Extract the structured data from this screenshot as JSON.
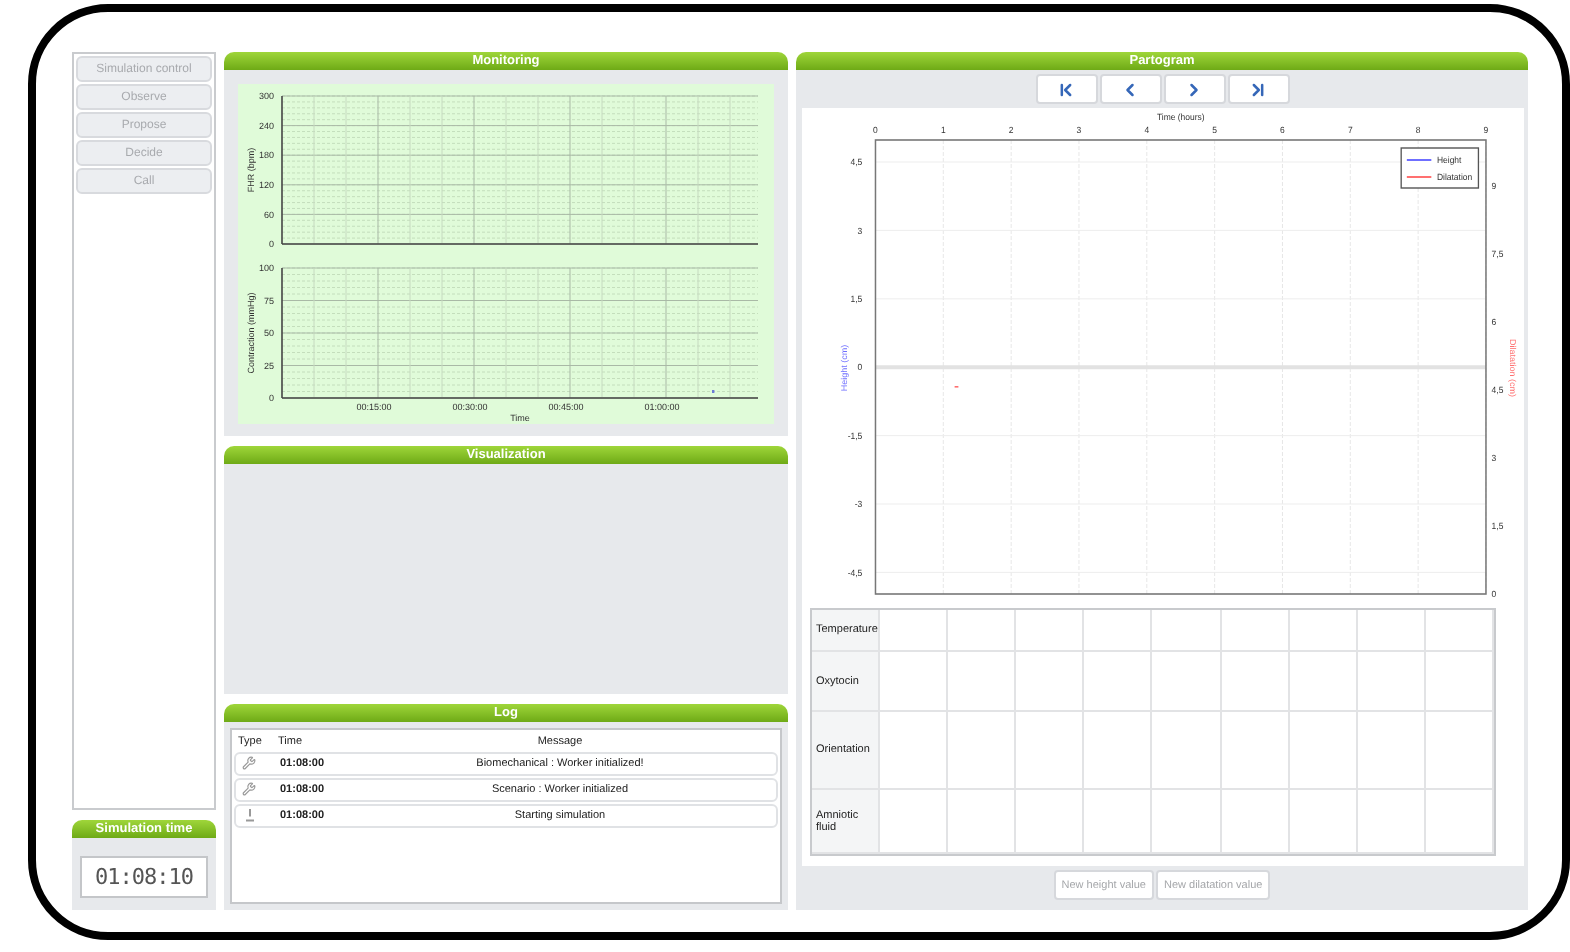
{
  "menu": {
    "items": [
      {
        "label": "Simulation control",
        "disabled": true
      },
      {
        "label": "Observe",
        "disabled": true
      },
      {
        "label": "Propose",
        "disabled": true
      },
      {
        "label": "Decide",
        "disabled": true
      },
      {
        "label": "Call",
        "disabled": true
      }
    ]
  },
  "simulation_time": {
    "title": "Simulation time",
    "value": "01:08:10"
  },
  "monitoring": {
    "title": "Monitoring",
    "charts": [
      {
        "ylabel": "FHR (bpm)",
        "yticks": [
          "300",
          "240",
          "180",
          "120",
          "60",
          "0"
        ]
      },
      {
        "ylabel": "Contraction (mmHg)",
        "yticks": [
          "100",
          "75",
          "50",
          "25",
          "0"
        ],
        "xticks": [
          "00:15:00",
          "00:30:00",
          "00:45:00",
          "01:00:00"
        ],
        "xlabel": "Time"
      }
    ]
  },
  "visualization": {
    "title": "Visualization"
  },
  "log": {
    "title": "Log",
    "columns": [
      "Type",
      "Time",
      "Message"
    ],
    "rows": [
      {
        "kind": "worker",
        "time": "01:08:00",
        "message": "Biomechanical : Worker initialized!"
      },
      {
        "kind": "worker",
        "time": "01:08:00",
        "message": "Scenario : Worker initialized"
      },
      {
        "kind": "info",
        "time": "01:08:00",
        "message": "Starting simulation"
      }
    ]
  },
  "partogram": {
    "title": "Partogram",
    "nav_buttons": [
      {
        "kind": "first"
      },
      {
        "kind": "previous"
      },
      {
        "kind": "next"
      },
      {
        "kind": "last"
      }
    ],
    "xlabel": "Time (hours)",
    "xticks": [
      "0",
      "1",
      "2",
      "3",
      "4",
      "5",
      "6",
      "7",
      "8",
      "9"
    ],
    "left_label": "Height (cm)",
    "left_yticks": [
      "4,5",
      "3",
      "1,5",
      "0",
      "-1,5",
      "-3",
      "-4,5"
    ],
    "right_label": "Dilatation (cm)",
    "right_yticks": [
      "9",
      "7,5",
      "6",
      "4,5",
      "3",
      "1,5",
      "0"
    ],
    "legend": [
      {
        "label": "Height",
        "color": "#6f6fff"
      },
      {
        "label": "Dilatation",
        "color": "#ff7070"
      }
    ],
    "table_rows": [
      "Temperature",
      "Oxytocin",
      "Orientation",
      "Amniotic fluid"
    ],
    "buttons": [
      {
        "label": "New height value",
        "disabled": true
      },
      {
        "label": "New dilatation value",
        "disabled": true
      }
    ]
  }
}
